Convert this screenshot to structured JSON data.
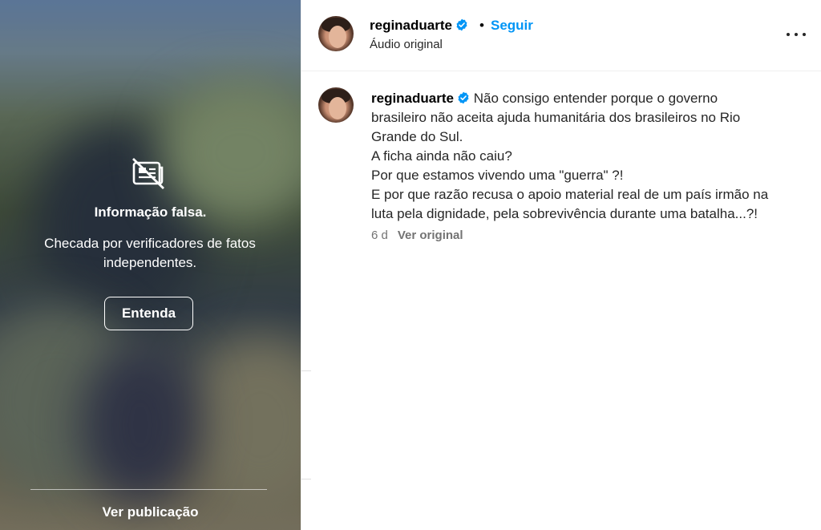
{
  "media": {
    "title": "Informação falsa.",
    "subtitle": "Checada por verificadores de fatos independentes.",
    "button_label": "Entenda",
    "footer_link": "Ver publicação",
    "icon": "false-info-icon"
  },
  "header": {
    "username": "reginaduarte",
    "verified": true,
    "separator": "•",
    "follow_label": "Seguir",
    "audio_label": "Áudio original",
    "more_icon": "more-options-icon"
  },
  "caption": {
    "username": "reginaduarte",
    "verified": true,
    "lines": [
      "Não consigo entender porque o governo",
      "brasileiro não aceita ajuda humanitária dos brasileiros no Rio",
      "Grande do Sul.",
      "A ficha ainda não caiu?",
      "Por que estamos vivendo uma \"guerra\" ?!",
      "E por que razão recusa o apoio material real de um país irmão na",
      "luta pela dignidade, pela sobrevivência durante uma batalha...?!"
    ],
    "time": "6 d",
    "translate_label": "Ver original"
  },
  "colors": {
    "accent": "#0095f6",
    "verified": "#0095f6",
    "muted_text": "#737373"
  }
}
